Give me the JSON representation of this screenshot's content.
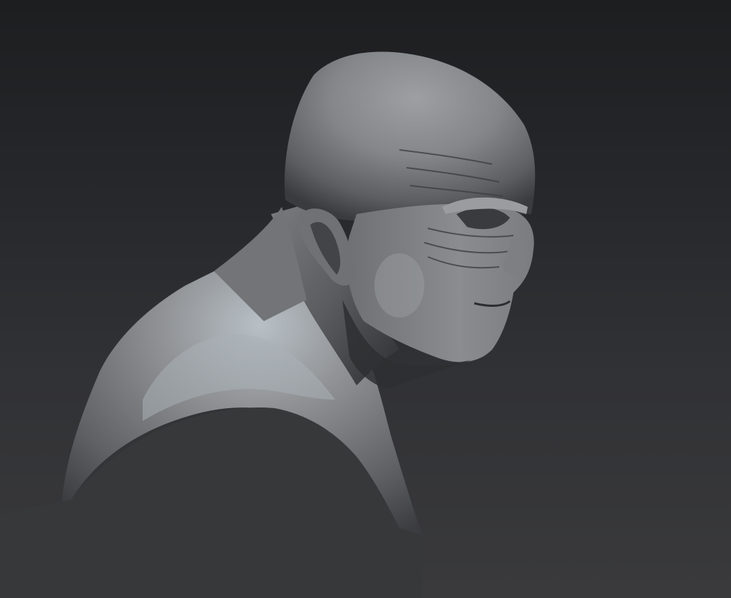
{
  "viewport": {
    "background_top": "#1d1e20",
    "background_bottom": "#3a3a3c"
  },
  "sculpt": {
    "subject": "clay-bust-old-man",
    "material_color": "#8a8b8e",
    "highlight_color": "#b9c2c8",
    "shadow_color": "#2b2c2e"
  }
}
